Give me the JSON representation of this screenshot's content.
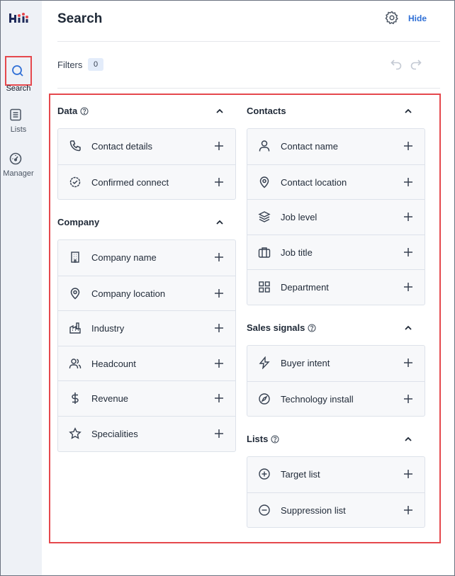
{
  "nav": {
    "items": [
      {
        "label": "Search",
        "icon": "search-icon",
        "active": true
      },
      {
        "label": "Lists",
        "icon": "list-icon"
      },
      {
        "label": "Manager",
        "icon": "gauge-icon"
      }
    ]
  },
  "header": {
    "title": "Search",
    "settings_icon": "gear-icon",
    "hide_label": "Hide"
  },
  "filters": {
    "label": "Filters",
    "count": "0"
  },
  "colors": {
    "accent": "#2f6fd6",
    "highlight": "#e5484d",
    "sidebar_bg": "#eef1f6",
    "card_bg": "#f7f8fa"
  },
  "sections": {
    "data": {
      "title": "Data",
      "items": [
        {
          "label": "Contact details",
          "icon": "phone-icon"
        },
        {
          "label": "Confirmed connect",
          "icon": "badge-check-icon"
        }
      ]
    },
    "company": {
      "title": "Company",
      "items": [
        {
          "label": "Company name",
          "icon": "building-icon"
        },
        {
          "label": "Company location",
          "icon": "map-pin-icon"
        },
        {
          "label": "Industry",
          "icon": "factory-icon"
        },
        {
          "label": "Headcount",
          "icon": "users-icon"
        },
        {
          "label": "Revenue",
          "icon": "dollar-icon"
        },
        {
          "label": "Specialities",
          "icon": "star-icon"
        }
      ]
    },
    "contacts": {
      "title": "Contacts",
      "items": [
        {
          "label": "Contact name",
          "icon": "user-icon"
        },
        {
          "label": "Contact location",
          "icon": "map-pin-icon"
        },
        {
          "label": "Job level",
          "icon": "layers-icon"
        },
        {
          "label": "Job title",
          "icon": "briefcase-icon"
        },
        {
          "label": "Department",
          "icon": "grid-icon"
        }
      ]
    },
    "sales_signals": {
      "title": "Sales signals",
      "items": [
        {
          "label": "Buyer intent",
          "icon": "bolt-icon"
        },
        {
          "label": "Technology install",
          "icon": "compass-icon"
        }
      ]
    },
    "lists": {
      "title": "Lists",
      "items": [
        {
          "label": "Target list",
          "icon": "plus-circle-icon"
        },
        {
          "label": "Suppression list",
          "icon": "minus-circle-icon"
        }
      ]
    }
  }
}
